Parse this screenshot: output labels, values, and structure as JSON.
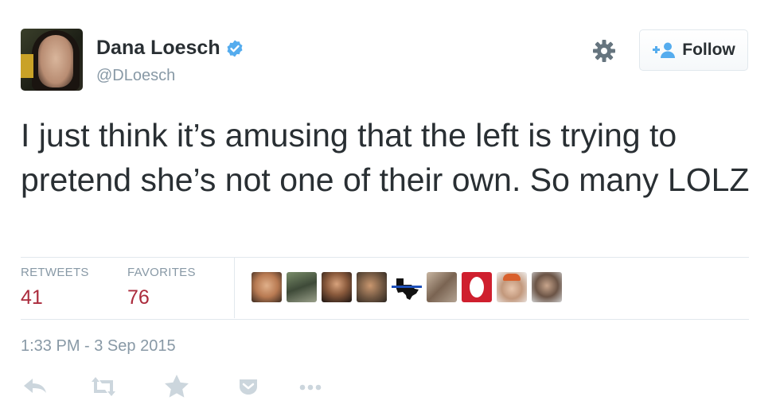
{
  "author": {
    "name": "Dana Loesch",
    "handle": "@DLoesch",
    "verified": true
  },
  "header": {
    "follow_label": "Follow"
  },
  "tweet": {
    "text": "I just think it’s amusing that the left is trying to pretend she’s not one of their own. So many LOLZ"
  },
  "stats": {
    "retweets_label": "RETWEETS",
    "retweets_count": "41",
    "favorites_label": "FAVORITES",
    "favorites_count": "76",
    "favoriter_avatar_count": 9
  },
  "timestamp": "1:33 PM - 3 Sep 2015",
  "icons": [
    "verified-badge-icon",
    "gear-icon",
    "follow-person-plus-icon",
    "reply-icon",
    "retweet-icon",
    "favorite-star-icon",
    "pocket-icon",
    "more-icon"
  ],
  "colors": {
    "text": "#292f33",
    "muted": "#8899a6",
    "verified": "#55acee",
    "count": "#ab2b3c",
    "border": "#e1e8ed"
  }
}
